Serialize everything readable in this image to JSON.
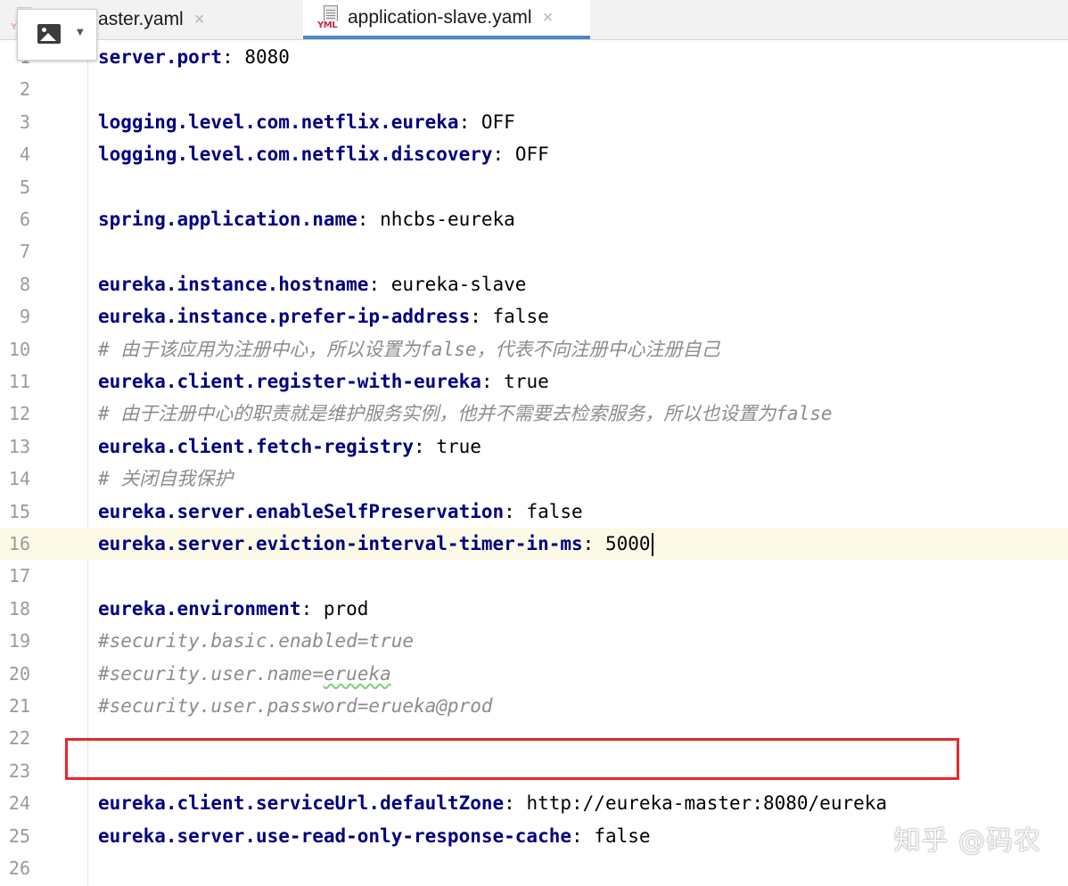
{
  "tabs": [
    {
      "label": "application-master.yaml",
      "visible_label": "ation-master.yaml",
      "icon": "yml-file-icon",
      "active": false
    },
    {
      "label": "application-slave.yaml",
      "icon": "yml-file-icon",
      "active": true
    }
  ],
  "tab_icon_text": "YML",
  "tab_close_glyph": "×",
  "lines": [
    {
      "n": "1",
      "key": "server.port",
      "sep": ": ",
      "val": "8080"
    },
    {
      "n": "2"
    },
    {
      "n": "3",
      "key": "logging.level.com.netflix.eureka",
      "sep": ": ",
      "val": "OFF"
    },
    {
      "n": "4",
      "key": "logging.level.com.netflix.discovery",
      "sep": ": ",
      "val": "OFF"
    },
    {
      "n": "5"
    },
    {
      "n": "6",
      "key": "spring.application.name",
      "sep": ": ",
      "val": "nhcbs-eureka"
    },
    {
      "n": "7"
    },
    {
      "n": "8",
      "key": "eureka.instance.hostname",
      "sep": ": ",
      "val": "eureka-slave"
    },
    {
      "n": "9",
      "key": "eureka.instance.prefer-ip-address",
      "sep": ": ",
      "val": "false"
    },
    {
      "n": "10",
      "comment": "# 由于该应用为注册中心，所以设置为false，代表不向注册中心注册自己"
    },
    {
      "n": "11",
      "key": "eureka.client.register-with-eureka",
      "sep": ": ",
      "val": "true"
    },
    {
      "n": "12",
      "comment": "# 由于注册中心的职责就是维护服务实例，他并不需要去检索服务，所以也设置为false"
    },
    {
      "n": "13",
      "key": "eureka.client.fetch-registry",
      "sep": ": ",
      "val": "true"
    },
    {
      "n": "14",
      "comment": "# 关闭自我保护"
    },
    {
      "n": "15",
      "key": "eureka.server.enableSelfPreservation",
      "sep": ": ",
      "val": "false"
    },
    {
      "n": "16",
      "key": "eureka.server.eviction-interval-timer-in-ms",
      "sep": ": ",
      "val": "5000",
      "current": true
    },
    {
      "n": "17"
    },
    {
      "n": "18",
      "key": "eureka.environment",
      "sep": ": ",
      "val": "prod"
    },
    {
      "n": "19",
      "comment": "#security.basic.enabled=true"
    },
    {
      "n": "20",
      "comment_pre": "#security.user.name=",
      "comment_squiggle": "erueka"
    },
    {
      "n": "21",
      "comment": "#security.user.password=erueka@prod"
    },
    {
      "n": "22"
    },
    {
      "n": "23"
    },
    {
      "n": "24",
      "key": "eureka.client.serviceUrl.defaultZone",
      "sep": ": ",
      "val": "http://eureka-master:8080/eureka",
      "highlighted": true
    },
    {
      "n": "25",
      "key": "eureka.server.use-read-only-response-cache",
      "sep": ": ",
      "val": "false"
    },
    {
      "n": "26"
    }
  ],
  "watermark": "知乎 @码农",
  "colors": {
    "key": "#000080",
    "comment": "#8c8c8c",
    "current_line": "#fcfae6",
    "highlight_box": "#e8262b",
    "active_tab_underline": "#4a86c5"
  }
}
